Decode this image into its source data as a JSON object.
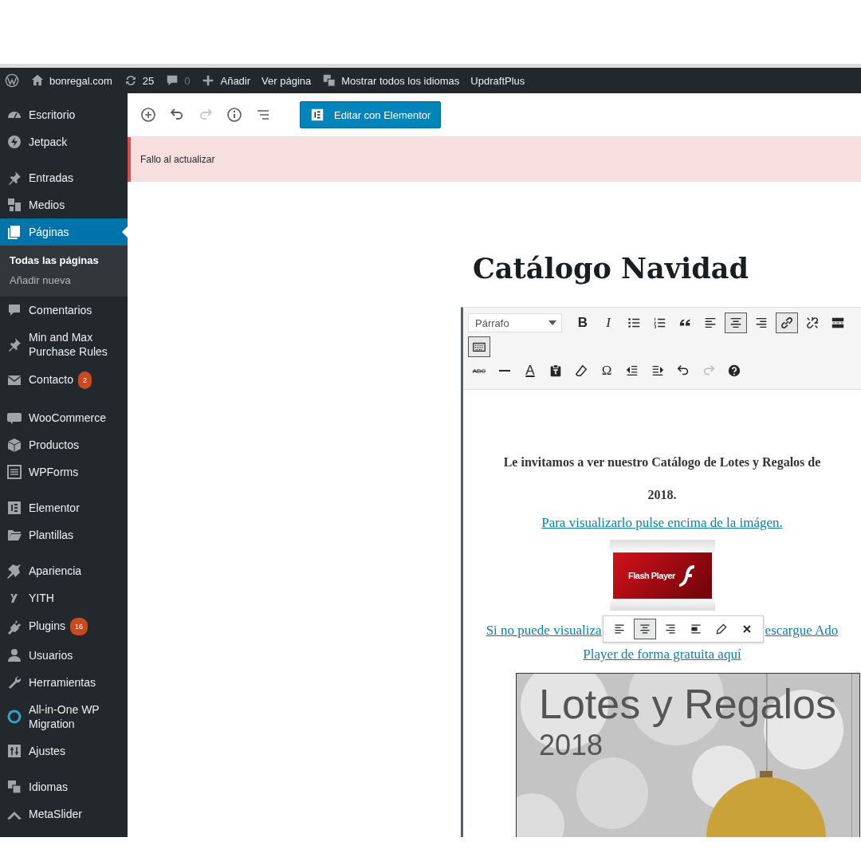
{
  "admin_bar": {
    "items": [
      {
        "kind": "wordpress"
      },
      {
        "kind": "home",
        "label": "bonregal.com"
      },
      {
        "kind": "refresh",
        "label": "25"
      },
      {
        "kind": "comment",
        "label": "0",
        "disabled": true
      },
      {
        "kind": "plus",
        "label": "Añadir"
      },
      {
        "kind": "text",
        "label": "Ver página"
      },
      {
        "kind": "translate",
        "label": "Mostrar todos los idiomas"
      },
      {
        "kind": "text",
        "label": "UpdraftPlus"
      }
    ]
  },
  "sidebar": {
    "groups": [
      [
        {
          "kind": "gauge",
          "label": "Escritorio",
          "selected": false
        },
        {
          "kind": "bolt",
          "label": "Jetpack",
          "selected": false
        }
      ],
      [
        {
          "kind": "pushpin",
          "label": "Entradas",
          "selected": false
        },
        {
          "kind": "media",
          "label": "Medios",
          "selected": false
        },
        {
          "kind": "pages",
          "label": "Páginas",
          "selected": true,
          "submenu": [
            {
              "label": "Todas las páginas",
              "selected": true
            },
            {
              "label": "Añadir nueva",
              "selected": false
            }
          ]
        },
        {
          "kind": "comment",
          "label": "Comentarios",
          "selected": false
        },
        {
          "kind": "pushpin",
          "label": "Min and Max Purchase Rules",
          "selected": false
        },
        {
          "kind": "envelope",
          "label": "Contacto",
          "badge": "2",
          "selected": false
        }
      ],
      [
        {
          "kind": "woo",
          "label": "WooCommerce",
          "selected": false
        },
        {
          "kind": "box",
          "label": "Productos",
          "selected": false
        },
        {
          "kind": "form",
          "label": "WPForms",
          "selected": false
        }
      ],
      [
        {
          "kind": "elementor",
          "label": "Elementor",
          "selected": false
        },
        {
          "kind": "folder",
          "label": "Plantillas",
          "selected": false
        }
      ],
      [
        {
          "kind": "brush",
          "label": "Apariencia",
          "selected": false
        },
        {
          "kind": "yith",
          "label": "YITH",
          "selected": false
        },
        {
          "kind": "plug",
          "label": "Plugins",
          "badge": "16",
          "selected": false
        },
        {
          "kind": "user",
          "label": "Usuarios",
          "selected": false
        },
        {
          "kind": "wrench",
          "label": "Herramientas",
          "selected": false
        },
        {
          "kind": "migration",
          "label": "All-in-One WP Migration",
          "selected": false
        },
        {
          "kind": "sliders",
          "label": "Ajustes",
          "selected": false
        }
      ],
      [
        {
          "kind": "translate",
          "label": "Idiomas",
          "selected": false
        },
        {
          "kind": "chevron",
          "label": "MetaSlider",
          "selected": false
        }
      ]
    ]
  },
  "toolbar": {
    "buttons": [
      {
        "kind": "add",
        "disabled": false
      },
      {
        "kind": "undo",
        "disabled": false
      },
      {
        "kind": "redo",
        "disabled": true
      },
      {
        "kind": "info",
        "disabled": false
      },
      {
        "kind": "outline",
        "disabled": false
      }
    ],
    "elementor_button": "Editar con Elementor"
  },
  "notice": {
    "text": "Fallo al actualizar"
  },
  "post": {
    "title": "Catálogo Navidad"
  },
  "editor": {
    "format_select": "Párrafo",
    "rows": [
      [
        {
          "kind": "bold",
          "glyph": "B",
          "active": false
        },
        {
          "kind": "italic",
          "glyph": "I",
          "active": false
        },
        {
          "kind": "bullet-list",
          "active": false
        },
        {
          "kind": "numbered-list",
          "active": false
        },
        {
          "kind": "quote",
          "active": false
        },
        {
          "kind": "align-left",
          "active": false
        },
        {
          "kind": "align-center",
          "active": true
        },
        {
          "kind": "align-right",
          "active": false
        },
        {
          "kind": "link",
          "active": true
        },
        {
          "kind": "unlink",
          "active": false
        },
        {
          "kind": "read-more",
          "active": false
        }
      ],
      [
        {
          "kind": "keyboard",
          "active": true
        }
      ],
      [
        {
          "kind": "strike",
          "glyph": "ABC",
          "active": false
        },
        {
          "kind": "horizontal-line",
          "active": false
        },
        {
          "kind": "color",
          "glyph": "A",
          "active": false
        },
        {
          "kind": "paste-text",
          "active": false
        },
        {
          "kind": "eraser",
          "active": false
        },
        {
          "kind": "plain",
          "glyph": "Ω",
          "active": false
        },
        {
          "kind": "outdent",
          "active": false
        },
        {
          "kind": "indent",
          "active": false
        },
        {
          "kind": "undo",
          "active": false,
          "disabled": false
        },
        {
          "kind": "redo",
          "active": false,
          "disabled": true
        },
        {
          "kind": "help",
          "active": false
        }
      ]
    ],
    "intro": "Le invitamos a ver nuestro Catálogo de Lotes y Regalos de",
    "year": "2018.",
    "link": "Para visualizarlo pulse encima de la imágen.",
    "flash_logo": "Flash Player",
    "link2_start": "Si no puede visualiza",
    "link2_end": "escargue Ado",
    "link2_line2": "Player de forma gratuita aquí",
    "image_toolbar": [
      {
        "kind": "align-left",
        "active": false
      },
      {
        "kind": "align-center",
        "active": true
      },
      {
        "kind": "align-right",
        "active": false
      },
      {
        "kind": "align-none",
        "active": false
      },
      {
        "kind": "edit",
        "active": false
      },
      {
        "kind": "remove",
        "active": false
      }
    ],
    "banner": {
      "heading": "Lotes y Regalos",
      "year": "2018"
    }
  }
}
